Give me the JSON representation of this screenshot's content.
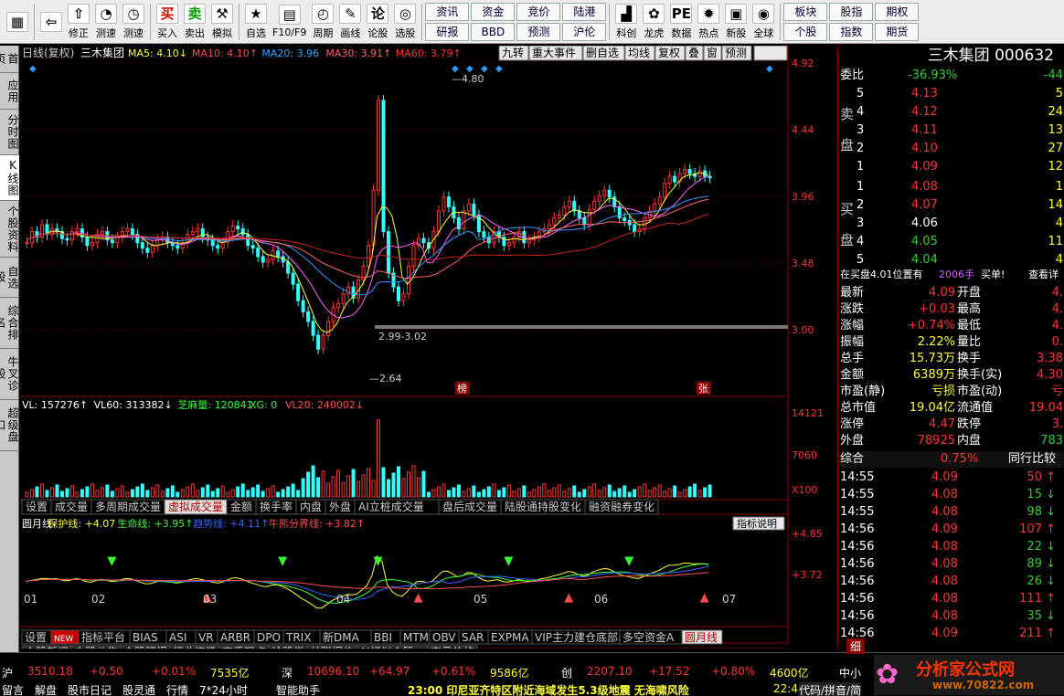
{
  "toolbar": {
    "buttons": [
      {
        "label": "",
        "icon": "logo-grid-icon"
      },
      {
        "label": "",
        "icon": "back-arrow-icon"
      },
      {
        "label": "修正",
        "icon": "up-arrow-icon"
      },
      {
        "label": "测速",
        "icon": "gauge-icon"
      },
      {
        "label": "测速",
        "icon": "clock-icon"
      },
      {
        "label": "买入",
        "icon": "buy-icon",
        "glyph": "买"
      },
      {
        "label": "卖出",
        "icon": "sell-icon",
        "glyph": "卖"
      },
      {
        "label": "模拟",
        "icon": "hammer-icon"
      },
      {
        "label": "自选",
        "icon": "star-icon"
      },
      {
        "label": "F10/F9",
        "icon": "f10-icon"
      },
      {
        "label": "周期",
        "icon": "period-icon"
      },
      {
        "label": "画线",
        "icon": "pencil-icon"
      },
      {
        "label": "论股",
        "icon": "lun-icon",
        "glyph": "论"
      },
      {
        "label": "选股",
        "icon": "select-icon"
      }
    ],
    "grid1": [
      "资讯",
      "资金",
      "竞价",
      "陆港",
      "研报",
      "BBD",
      "预测",
      "沪伦"
    ],
    "grid1b": [
      {
        "label": "科创",
        "icon": "chart-icon"
      },
      {
        "label": "龙虎",
        "icon": "ribbon-icon"
      },
      {
        "label": "数据",
        "icon": "pe-icon"
      },
      {
        "label": "热点",
        "icon": "hot-icon"
      },
      {
        "label": "新股",
        "icon": "newstock-icon"
      },
      {
        "label": "全球",
        "icon": "globe-icon"
      }
    ],
    "grid2": [
      "板块",
      "股指",
      "期权",
      "个股",
      "指数",
      "期货"
    ]
  },
  "leftnav": [
    "首页",
    "应用",
    "分时图",
    "K线图",
    "个股资料",
    "自选股",
    "综合排名",
    "牛叉诊股",
    "超级盘口"
  ],
  "chart": {
    "title": "日线(复权)",
    "stock": "三木集团",
    "ma": [
      {
        "t": "MA5: 4.10↓",
        "c": "#ffff33"
      },
      {
        "t": "MA10: 4.10↑",
        "c": "#ff4d4d"
      },
      {
        "t": "MA20: 3.96",
        "c": "#33aaff"
      },
      {
        "t": "MA30: 3.91↑",
        "c": "#ff6666"
      },
      {
        "t": "MA60: 3.79↑",
        "c": "#ff3333"
      }
    ],
    "topbtns": [
      "九转",
      "重大事件",
      "删自选",
      "均线",
      "复权",
      "叠",
      "窗",
      "预测"
    ],
    "ylabels": [
      "4.92",
      "4.44",
      "3.96",
      "3.48",
      "3.00"
    ],
    "marks": {
      "hi": "4.80",
      "lo": "2.64",
      "range": "2.99-3.02",
      "bang": "榜",
      "zhang": "张"
    },
    "vol": {
      "line": [
        {
          "t": "VL: 157276↑",
          "c": "#fff"
        },
        {
          "t": "VL60: 313382↓",
          "c": "#fff"
        },
        {
          "t": "芝麻量: 120841",
          "c": "#33ff33"
        },
        {
          "t": "XG: 0",
          "c": "#33ff33"
        },
        {
          "t": "VL20: 240002↓",
          "c": "#ff4d4d"
        }
      ],
      "ylabels": [
        "14121",
        "7060",
        "X100"
      ]
    },
    "tabs1": [
      "设置",
      "成交量",
      "多周期成交量",
      "虚拟成交量",
      "金额",
      "换手率",
      "内盘",
      "外盘",
      "AI立桩成交量",
      "盘后成交量",
      "陆股通持股变化",
      "融资融券变化"
    ],
    "tabs1_active": "虚拟成交量",
    "ind": {
      "line": [
        {
          "t": "圆月线",
          "c": "#fff"
        },
        {
          "t": "保护线: +4.07",
          "c": "#ffff33"
        },
        {
          "t": "生命线: +3.95↑",
          "c": "#33ff33"
        },
        {
          "t": "趋势线: +4.11↑",
          "c": "#3366ff"
        },
        {
          "t": "牛熊分界线: +3.82↑",
          "c": "#ff4d4d"
        }
      ],
      "btn": "指标说明",
      "ylabels": [
        "+4.85",
        "+3.72"
      ]
    },
    "months": [
      "01",
      "02",
      "03",
      "04",
      "05",
      "06",
      "07"
    ],
    "tabs2": [
      "设置",
      "NEW",
      "指标平台",
      "BIAS",
      "ASI",
      "VR",
      "ARBR",
      "DPO",
      "TRIX",
      "新DMA",
      "BBI",
      "MTM",
      "OBV",
      "SAR",
      "EXPMA",
      "VIP主力建仓底部出击",
      "多空资金A",
      "圆月线"
    ],
    "tabs2_active": "圆月线",
    "tabs3": [
      "个股新闻",
      "个股公告",
      "个股研报",
      "行业资讯",
      "高手观点",
      "论股堂",
      "关联报价",
      "AI相似个股",
      "商品价格"
    ]
  },
  "right": {
    "name": "三木集团 000632",
    "weibi": {
      "label": "委比",
      "v1": "-36.93%",
      "v2": "-44"
    },
    "sell": [
      [
        "5",
        "4.13",
        "5"
      ],
      [
        "4",
        "4.12",
        "24"
      ],
      [
        "3",
        "4.11",
        "13"
      ],
      [
        "2",
        "4.10",
        "27"
      ],
      [
        "1",
        "4.09",
        "12"
      ]
    ],
    "buy": [
      [
        "1",
        "4.08",
        "1"
      ],
      [
        "2",
        "4.07",
        "14"
      ],
      [
        "3",
        "4.06",
        "4"
      ],
      [
        "4",
        "4.05",
        "11"
      ],
      [
        "5",
        "4.04",
        "4"
      ]
    ],
    "sellLabel": [
      "卖",
      "盘"
    ],
    "buyLabel": [
      "买",
      "盘"
    ],
    "note": [
      "在买盘4.01位置有",
      "2006手",
      "买单!",
      "查看详"
    ],
    "stats": [
      [
        "最新",
        "4.09",
        "开盘",
        "4."
      ],
      [
        "涨跌",
        "+0.03",
        "最高",
        "4."
      ],
      [
        "涨幅",
        "+0.74%",
        "最低",
        "4."
      ],
      [
        "振幅",
        "2.22%",
        "量比",
        "0."
      ],
      [
        "总手",
        "15.73万",
        "换手",
        "3.38"
      ],
      [
        "金额",
        "6389万",
        "换手(实)",
        "4.30"
      ],
      [
        "市盈(静)",
        "亏损",
        "市盈(动)",
        "亏"
      ],
      [
        "总市值",
        "19.04亿",
        "流通值",
        "19.04"
      ],
      [
        "涨停",
        "4.47",
        "跌停",
        "3."
      ],
      [
        "外盘",
        "78925",
        "内盘",
        "783"
      ]
    ],
    "zonghe": [
      "综合",
      "0.75%",
      "同行比较"
    ],
    "ticks": [
      [
        "14:55",
        "4.09",
        "50",
        "up"
      ],
      [
        "14:55",
        "4.08",
        "15",
        "dn"
      ],
      [
        "14:55",
        "4.08",
        "98",
        "dn"
      ],
      [
        "14:56",
        "4.09",
        "107",
        "up"
      ],
      [
        "14:56",
        "4.08",
        "22",
        "dn"
      ],
      [
        "14:56",
        "4.08",
        "89",
        "dn"
      ],
      [
        "14:56",
        "4.08",
        "26",
        "dn"
      ],
      [
        "14:56",
        "4.08",
        "111",
        "up"
      ],
      [
        "14:56",
        "4.08",
        "35",
        "dn"
      ],
      [
        "14:56",
        "4.09",
        "211",
        "up"
      ]
    ]
  },
  "status": {
    "idx": [
      {
        "n": "沪",
        "v": "3510.18",
        "c": "+0.50",
        "p": "+0.01%",
        "a": "7535亿"
      },
      {
        "n": "深",
        "v": "10696.10",
        "c": "+64.97",
        "p": "+0.61%",
        "a": "9586亿"
      },
      {
        "n": "创",
        "v": "2207.10",
        "c": "+17.52",
        "p": "+0.80%",
        "a": "4600亿"
      }
    ],
    "idx_extra": "中小",
    "bottom": [
      "留言",
      "解盘",
      "股市日记",
      "股灵通",
      "行情",
      "7*24小时",
      "智能助手"
    ],
    "news": "23:00 印尼亚齐特区附近海域发生5.3级地震 无海啸风险",
    "time": "22:4",
    "code": "代码/拼音/简",
    "brand": "分析家公式网",
    "brand_url": "www.70822.com",
    "detail": "细"
  }
}
